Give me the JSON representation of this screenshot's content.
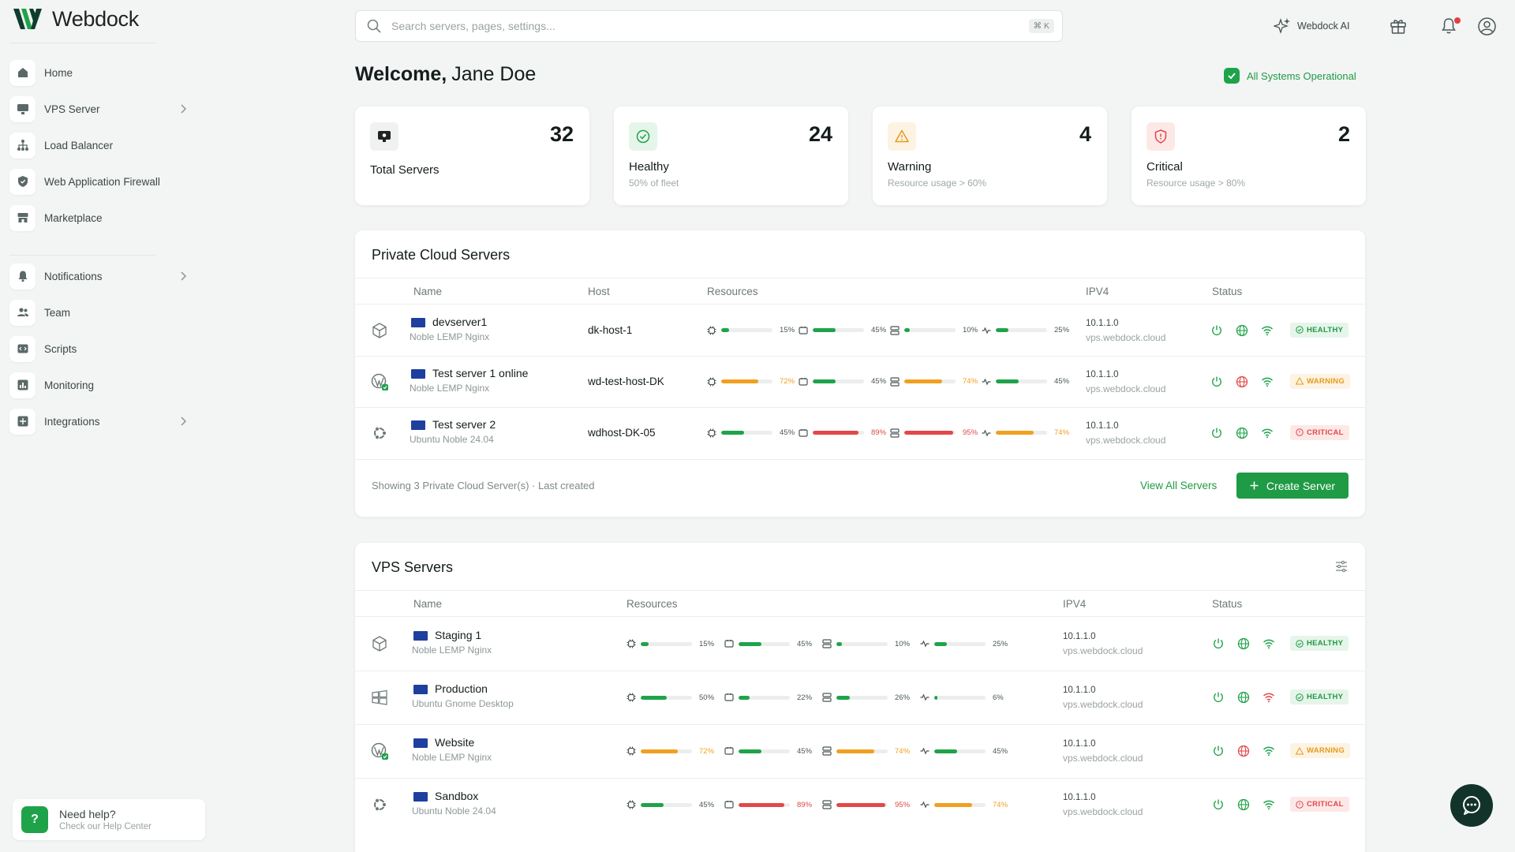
{
  "brand": {
    "name": "Webdock",
    "accent": "#1fa34a"
  },
  "search": {
    "placeholder": "Search servers, pages, settings...",
    "shortcut": "⌘ K"
  },
  "topbar": {
    "ai_label": "Webdock AI"
  },
  "sidebar": {
    "items": [
      {
        "label": "Home",
        "icon": "home-icon"
      },
      {
        "label": "VPS Server",
        "icon": "monitor-icon",
        "chevron": true
      },
      {
        "label": "Load Balancer",
        "icon": "network-icon"
      },
      {
        "label": "Web Application Firewall",
        "icon": "shield-icon"
      },
      {
        "label": "Marketplace",
        "icon": "store-icon"
      },
      {
        "label": "Notifications",
        "icon": "bell-icon",
        "chevron": true
      },
      {
        "label": "Team",
        "icon": "users-icon"
      },
      {
        "label": "Scripts",
        "icon": "code-icon"
      },
      {
        "label": "Monitoring",
        "icon": "chart-icon"
      },
      {
        "label": "Integrations",
        "icon": "puzzle-icon",
        "chevron": true
      }
    ],
    "help": {
      "title": "Need help?",
      "subtitle": "Check our Help Center"
    }
  },
  "welcome": {
    "greeting": "Welcome,",
    "name": "Jane Doe",
    "status": "All Systems Operational"
  },
  "stats": [
    {
      "value": "32",
      "title": "Total Servers",
      "subtitle": ""
    },
    {
      "value": "24",
      "title": "Healthy",
      "subtitle": "50% of fleet"
    },
    {
      "value": "4",
      "title": "Warning",
      "subtitle": "Resource usage > 60%"
    },
    {
      "value": "2",
      "title": "Critical",
      "subtitle": "Resource usage > 80%"
    }
  ],
  "private_cloud": {
    "title": "Private Cloud Servers",
    "columns": {
      "name": "Name",
      "host": "Host",
      "resources": "Resources",
      "ipv4": "IPV4",
      "status": "Status"
    },
    "rows": [
      {
        "name": "devserver1",
        "sub": "Noble LEMP Nginx",
        "host": "dk-host-1",
        "ip": "10.1.1.0",
        "domain": "vps.webdock.cloud",
        "res": [
          "15%",
          "45%",
          "10%",
          "25%"
        ],
        "status": "HEALTHY"
      },
      {
        "name": "Test server 1 online",
        "sub": "Noble LEMP Nginx",
        "host": "wd-test-host-DK",
        "ip": "10.1.1.0",
        "domain": "vps.webdock.cloud",
        "res": [
          "72%",
          "45%",
          "74%",
          "45%"
        ],
        "status": "WARNING"
      },
      {
        "name": "Test server 2",
        "sub": "Ubuntu Noble 24.04",
        "host": "wdhost-DK-05",
        "ip": "10.1.1.0",
        "domain": "vps.webdock.cloud",
        "res": [
          "45%",
          "89%",
          "95%",
          "74%"
        ],
        "status": "CRITICAL"
      }
    ],
    "footer": "Showing 3 Private Cloud Server(s) · Last created",
    "view_all": "View All Servers",
    "create": "Create Server"
  },
  "vps": {
    "title": "VPS Servers",
    "columns": {
      "name": "Name",
      "resources": "Resources",
      "ipv4": "IPV4",
      "status": "Status"
    },
    "rows": [
      {
        "name": "Staging 1",
        "sub": "Noble LEMP Nginx",
        "ip": "10.1.1.0",
        "domain": "vps.webdock.cloud",
        "res": [
          "15%",
          "45%",
          "10%",
          "25%"
        ],
        "status": "HEALTHY"
      },
      {
        "name": "Production",
        "sub": "Ubuntu Gnome Desktop",
        "ip": "10.1.1.0",
        "domain": "vps.webdock.cloud",
        "res": [
          "50%",
          "22%",
          "26%",
          "6%"
        ],
        "status": "HEALTHY"
      },
      {
        "name": "Website",
        "sub": "Noble LEMP Nginx",
        "ip": "10.1.1.0",
        "domain": "vps.webdock.cloud",
        "res": [
          "72%",
          "45%",
          "74%",
          "45%"
        ],
        "status": "WARNING"
      },
      {
        "name": "Sandbox",
        "sub": "Ubuntu Noble 24.04",
        "ip": "10.1.1.0",
        "domain": "vps.webdock.cloud",
        "res": [
          "45%",
          "89%",
          "95%",
          "74%"
        ],
        "status": "CRITICAL"
      }
    ]
  },
  "colors": {
    "green": "#1fa34a",
    "orange": "#f0a020",
    "red": "#e24848"
  }
}
